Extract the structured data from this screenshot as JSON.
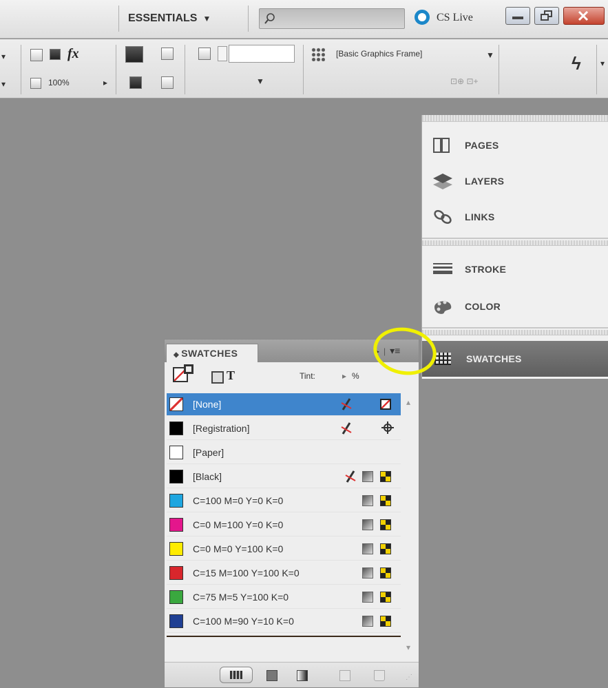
{
  "appbar": {
    "workspace_label": "ESSENTIALS",
    "workspace_caret": "▼",
    "cs_live_label": "CS Live"
  },
  "controlbar": {
    "zoom_value": "100%",
    "object_style_value": "[Basic Graphics Frame]"
  },
  "dock": {
    "items": [
      {
        "label": "PAGES",
        "icon": "pages-icon"
      },
      {
        "label": "LAYERS",
        "icon": "layers-icon"
      },
      {
        "label": "LINKS",
        "icon": "links-icon"
      },
      {
        "label": "STROKE",
        "icon": "stroke-icon"
      },
      {
        "label": "COLOR",
        "icon": "color-icon"
      },
      {
        "label": "SWATCHES",
        "icon": "swatches-icon"
      }
    ]
  },
  "swatches_panel": {
    "title": "SWATCHES",
    "tint_label": "Tint:",
    "tint_unit": "%",
    "rows": [
      {
        "name": "[None]",
        "color": "#ffffff",
        "selected": true
      },
      {
        "name": "[Registration]",
        "color": "#000000"
      },
      {
        "name": "[Paper]",
        "color": "#ffffff"
      },
      {
        "name": "[Black]",
        "color": "#000000"
      },
      {
        "name": "C=100 M=0 Y=0 K=0",
        "color": "#1ea6e0"
      },
      {
        "name": "C=0 M=100 Y=0 K=0",
        "color": "#e4168c"
      },
      {
        "name": "C=0 M=0 Y=100 K=0",
        "color": "#ffec00"
      },
      {
        "name": "C=15 M=100 Y=100 K=0",
        "color": "#d8262c"
      },
      {
        "name": "C=75 M=5 Y=100 K=0",
        "color": "#3aa83f"
      },
      {
        "name": "C=100 M=90 Y=10 K=0",
        "color": "#1f3f93"
      }
    ]
  },
  "colors": {
    "selection": "#3f85cc",
    "highlight": "#f0f000"
  }
}
